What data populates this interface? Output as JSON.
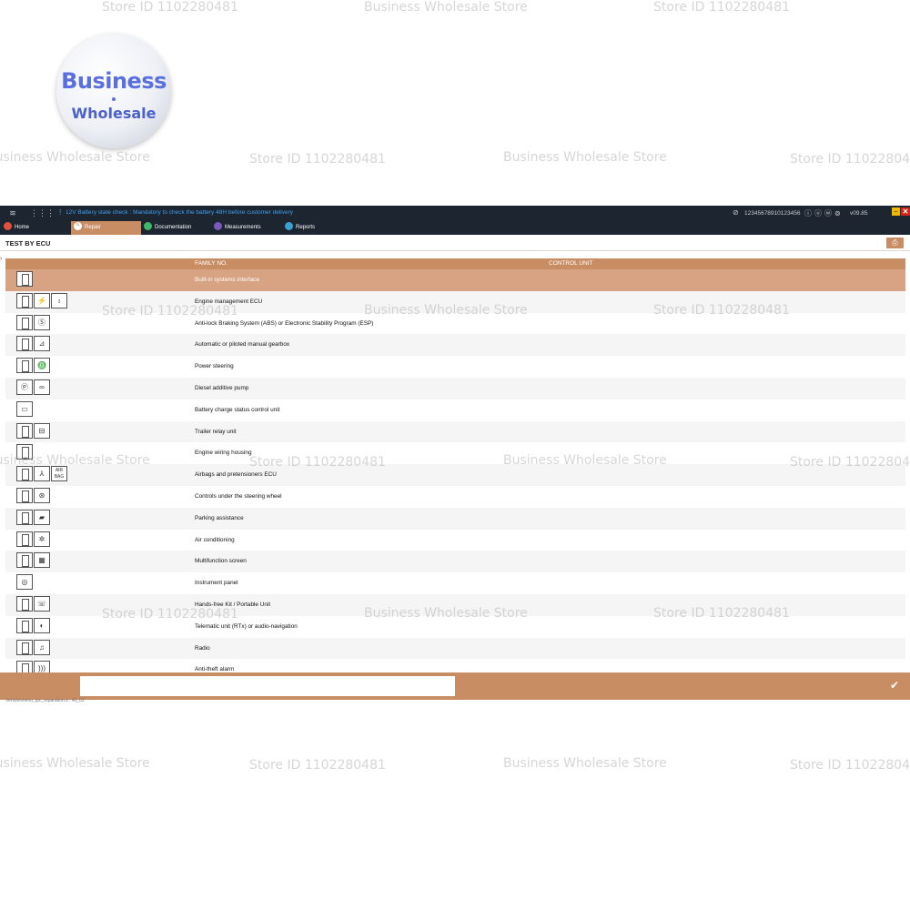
{
  "watermarks": [
    {
      "text": "Store ID 1102280481"
    },
    {
      "text": "Business Wholesale Store"
    }
  ],
  "logo": {
    "line1": "Business",
    "line2": "Wholesale"
  },
  "topbar": {
    "brand_icon": "citroen-logo-icon",
    "alert": "12V Battery state check : Mandatory to check the battery 48H before customer delivery",
    "vin": "12345678910123456",
    "version": "v09.85"
  },
  "tabs": [
    {
      "label": "Home",
      "icon_color": "#e0503a",
      "active": false
    },
    {
      "label": "Repair",
      "icon_color": "#c98d64",
      "active": true
    },
    {
      "label": "Documentation",
      "icon_color": "#3fb86a",
      "active": false
    },
    {
      "label": "Measurements",
      "icon_color": "#7a5ab8",
      "active": false
    },
    {
      "label": "Reports",
      "icon_color": "#3ea0d0",
      "active": false
    }
  ],
  "page": {
    "title": "TEST BY ECU"
  },
  "table": {
    "columns": [
      "FAMILY NO.",
      "CONTROL UNIT"
    ],
    "rows": [
      {
        "label": "Built-in systems interface",
        "icons": [
          ""
        ],
        "selected": true
      },
      {
        "label": "Engine management ECU",
        "icons": [
          "",
          "⚡",
          "♁"
        ]
      },
      {
        "label": "Anti-lock Braking System (ABS) or Electronic Stability Program (ESP)",
        "icons": [
          "",
          "Ⓢ"
        ]
      },
      {
        "label": "Automatic or piloted manual gearbox",
        "icons": [
          "",
          "⊿"
        ]
      },
      {
        "label": "Power steering",
        "icons": [
          "",
          "♎"
        ]
      },
      {
        "label": "Diesel additive pump",
        "icons": [
          "Ⓟ",
          "∞"
        ]
      },
      {
        "label": "Battery charge status control unit",
        "icons": [
          "▭"
        ]
      },
      {
        "label": "Trailer relay unit",
        "icons": [
          "",
          "⊟"
        ]
      },
      {
        "label": "Engine wiring housing",
        "icons": [
          ""
        ]
      },
      {
        "label": "Airbags and pretensioners ECU",
        "icons": [
          "",
          "⅄",
          "AIR BAG"
        ]
      },
      {
        "label": "Controls under the steering wheel",
        "icons": [
          "",
          "⊛"
        ]
      },
      {
        "label": "Parking assistance",
        "icons": [
          "",
          "▰"
        ]
      },
      {
        "label": "Air conditioning",
        "icons": [
          "",
          "✲"
        ]
      },
      {
        "label": "Multifunction screen",
        "icons": [
          "",
          "▦"
        ]
      },
      {
        "label": "Instrument panel",
        "icons": [
          "◎"
        ]
      },
      {
        "label": "Hands-free Kit / Portable Unit",
        "icons": [
          "",
          "☏"
        ]
      },
      {
        "label": "Telematic unit (RTx) or audio-navigation",
        "icons": [
          "",
          "◐"
        ]
      },
      {
        "label": "Radio",
        "icons": [
          "",
          "♫"
        ]
      },
      {
        "label": "Anti-theft alarm",
        "icons": [
          "",
          ")))"
        ]
      }
    ]
  },
  "footer": {
    "input_value": "",
    "status": "Vehicle\\menu_tpc_reparation.s : 40_02"
  }
}
